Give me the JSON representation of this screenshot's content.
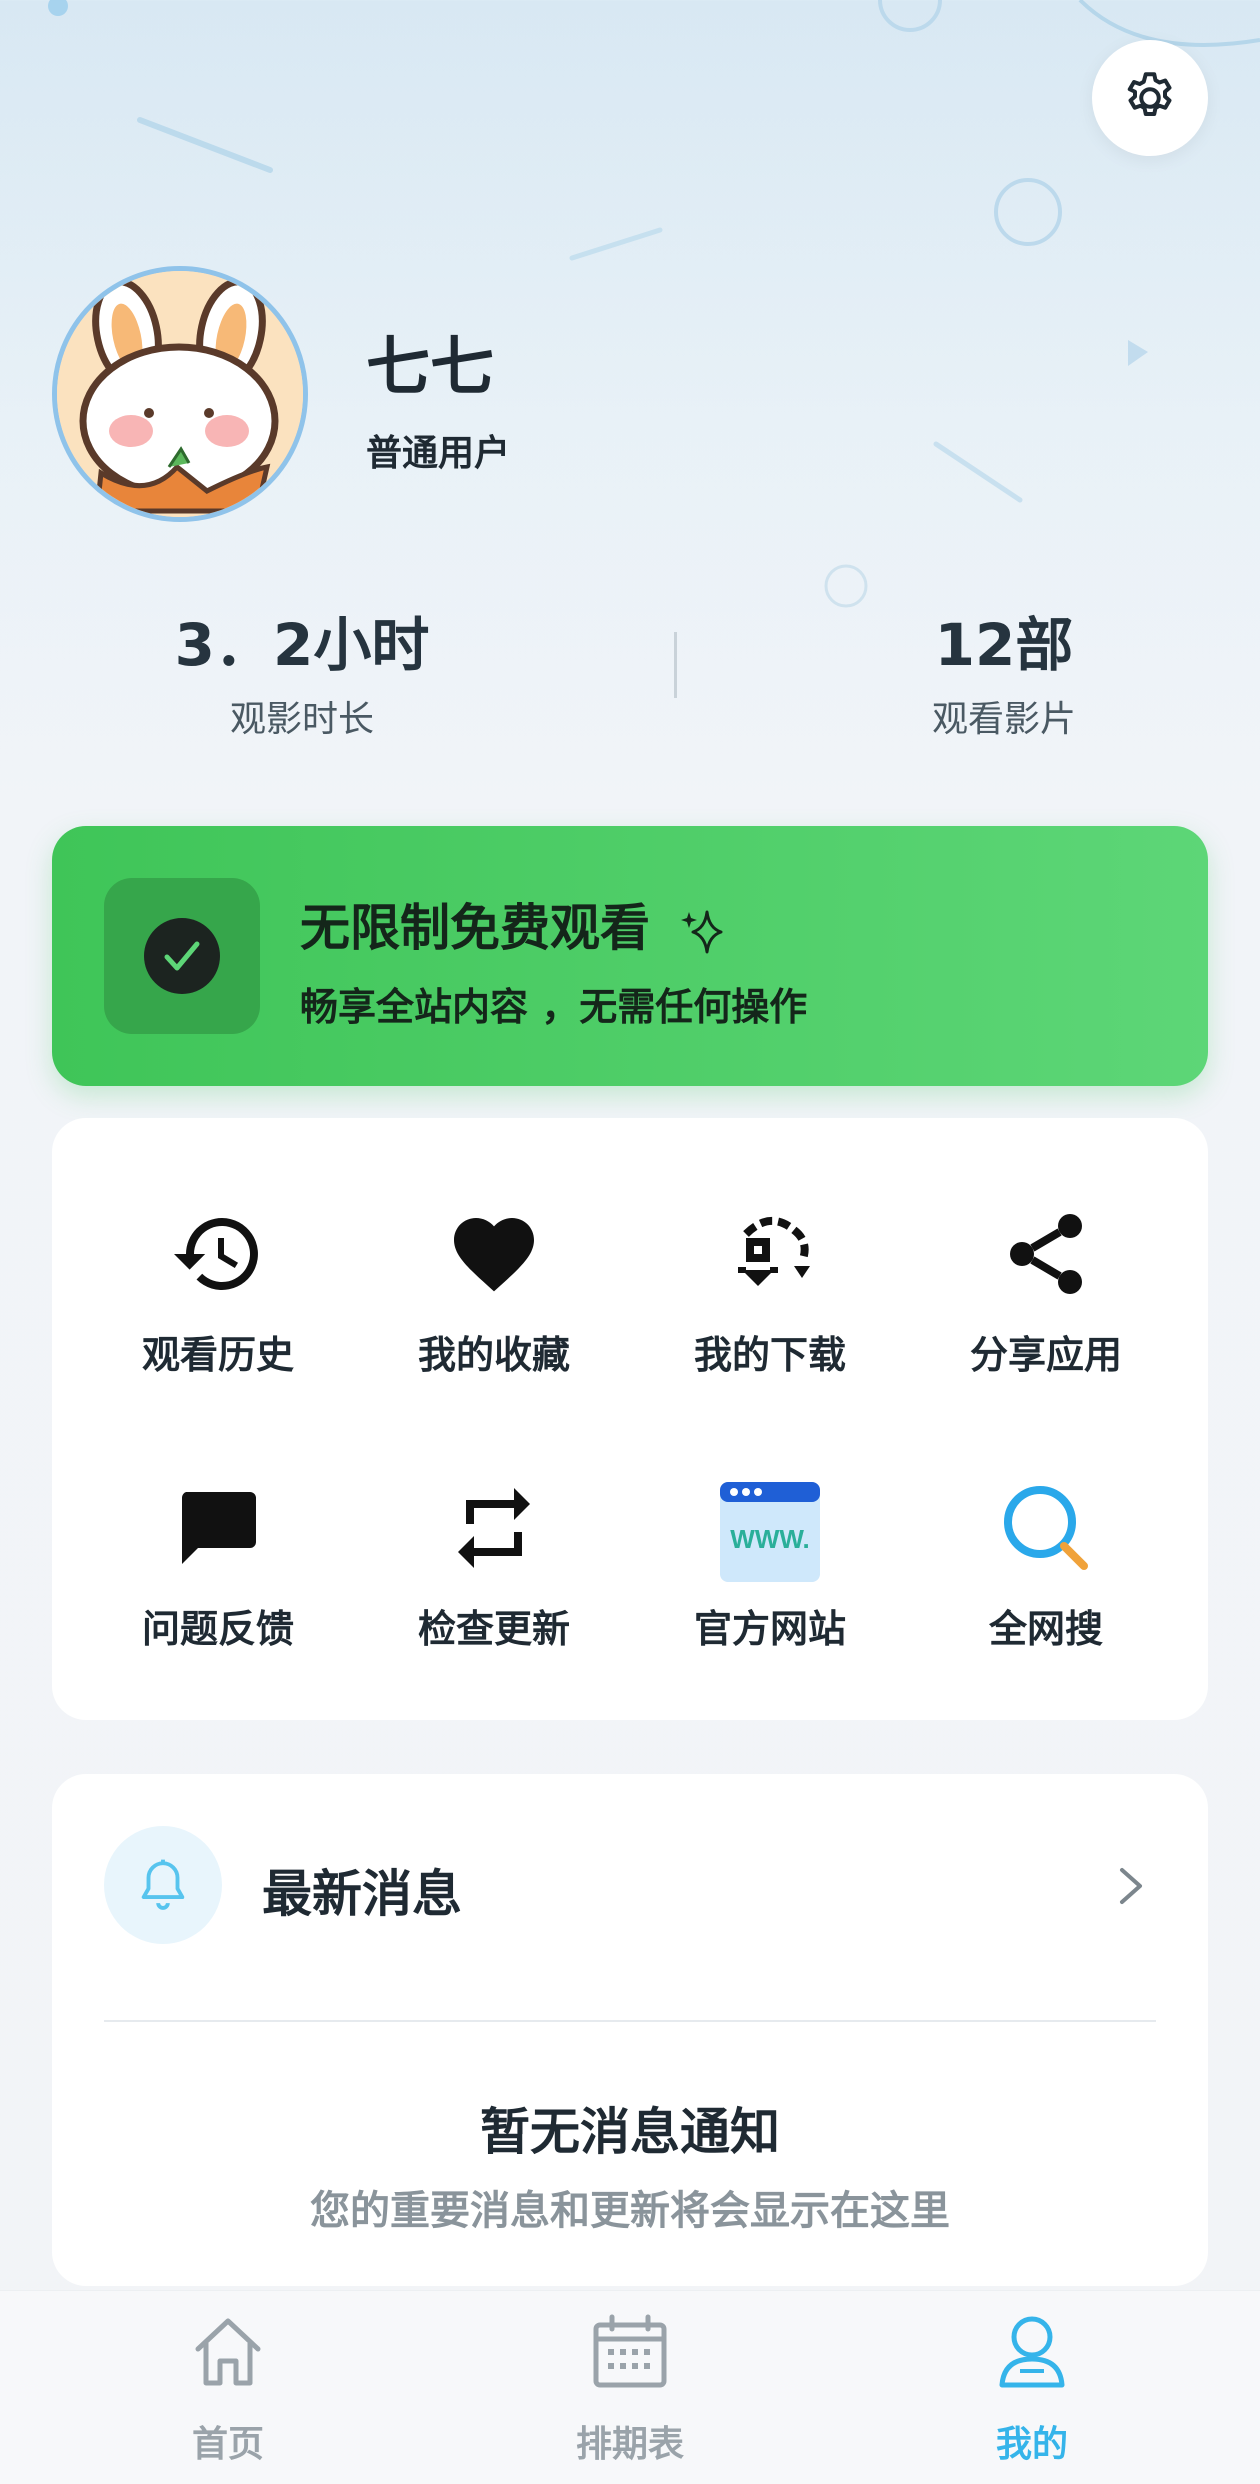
{
  "profile": {
    "name": "七七",
    "user_type": "普通用户"
  },
  "stats": {
    "watch_time_value": "3．2小时",
    "watch_time_label": "观影时长",
    "movies_value": "12部",
    "movies_label": "观看影片"
  },
  "promo": {
    "title": "无限制免费观看",
    "subtitle": "畅享全站内容 ，无需任何操作",
    "color": "#4ccd66"
  },
  "grid": [
    {
      "label": "观看历史",
      "icon": "history-icon"
    },
    {
      "label": "我的收藏",
      "icon": "heart-icon"
    },
    {
      "label": "我的下载",
      "icon": "download-icon"
    },
    {
      "label": "分享应用",
      "icon": "share-icon"
    },
    {
      "label": "问题反馈",
      "icon": "feedback-icon"
    },
    {
      "label": "检查更新",
      "icon": "update-icon"
    },
    {
      "label": "官方网站",
      "icon": "website-icon"
    },
    {
      "label": "全网搜",
      "icon": "search-icon"
    }
  ],
  "website_icon_text": "WWW.",
  "messages": {
    "title": "最新消息",
    "empty_title": "暂无消息通知",
    "empty_subtitle": "您的重要消息和更新将会显示在这里"
  },
  "nav": {
    "items": [
      {
        "label": "首页",
        "icon": "home-icon",
        "active": false
      },
      {
        "label": "排期表",
        "icon": "calendar-icon",
        "active": false
      },
      {
        "label": "我的",
        "icon": "user-icon",
        "active": true
      }
    ],
    "active_color": "#35b4ea",
    "inactive_color": "#9aa3aa"
  }
}
